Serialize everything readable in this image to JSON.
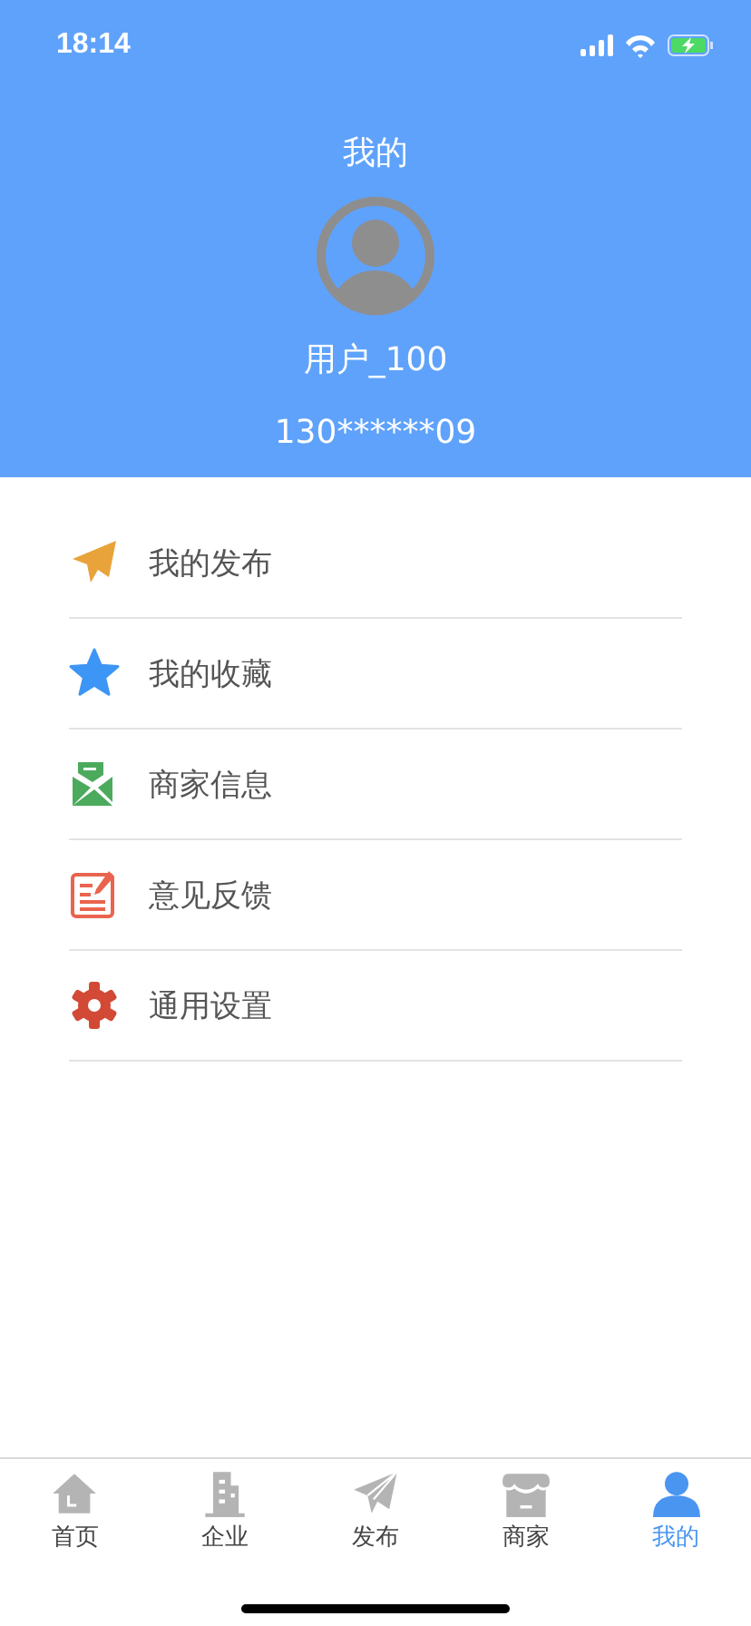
{
  "status_bar": {
    "time": "18:14"
  },
  "header": {
    "title": "我的",
    "username": "用户_100",
    "phone": "130******09"
  },
  "menu": [
    {
      "label": "我的发布",
      "kind": "send"
    },
    {
      "label": "我的收藏",
      "kind": "star"
    },
    {
      "label": "商家信息",
      "kind": "mail"
    },
    {
      "label": "意见反馈",
      "kind": "note"
    },
    {
      "label": "通用设置",
      "kind": "gear"
    }
  ],
  "tab_bar": [
    {
      "label": "首页",
      "kind": "home",
      "selected": false
    },
    {
      "label": "企业",
      "kind": "building",
      "selected": false
    },
    {
      "label": "发布",
      "kind": "send",
      "selected": false
    },
    {
      "label": "商家",
      "kind": "shop",
      "selected": false
    },
    {
      "label": "我的",
      "kind": "person",
      "selected": true
    }
  ]
}
